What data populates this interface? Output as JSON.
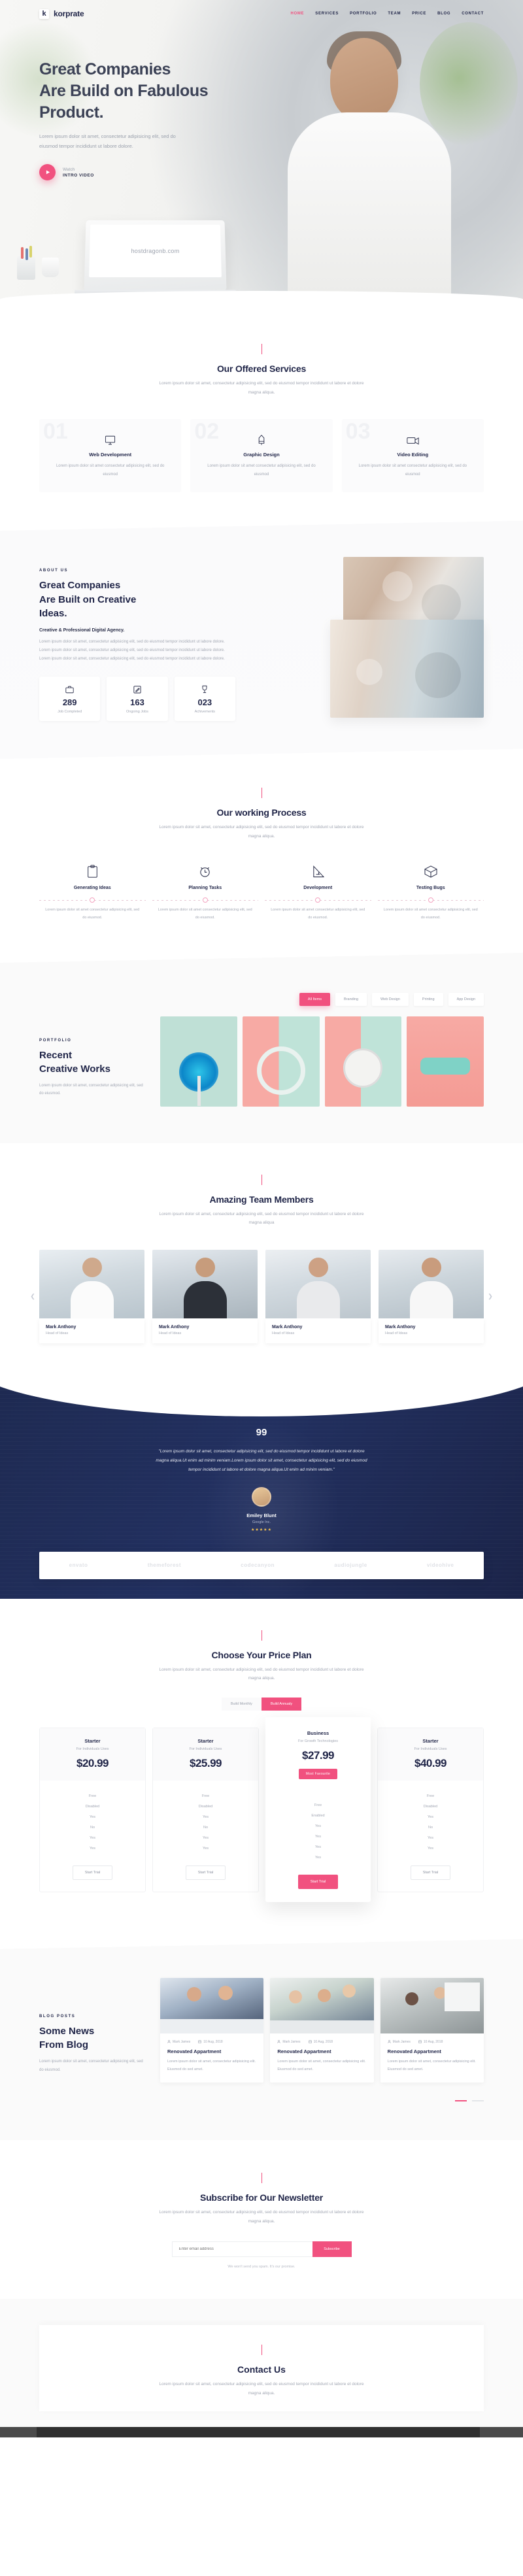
{
  "brand": {
    "mark": "k",
    "name": "korprate",
    "accent": "#f1517f",
    "dark": "#1f2447"
  },
  "nav": {
    "items": [
      {
        "label": "HOME",
        "active": true
      },
      {
        "label": "SERVICES",
        "active": false
      },
      {
        "label": "PORTFOLIO",
        "active": false
      },
      {
        "label": "TEAM",
        "active": false
      },
      {
        "label": "PRICE",
        "active": false
      },
      {
        "label": "BLOG",
        "active": false
      },
      {
        "label": "CONTACT",
        "active": false
      }
    ]
  },
  "hero": {
    "title_line1": "Great Companies",
    "title_line2": "Are Build on Fabulous",
    "title_line3": "Product.",
    "subtitle": "Lorem ipsum dolor sit amet, consectetur adipisicing elit, sed do eiusmod tempor incididunt ut labore dolore.",
    "watch_top": "Watch",
    "watch_bottom": "INTRO VIDEO",
    "screen_url": "hostdragonb.com"
  },
  "services": {
    "title": "Our Offered Services",
    "desc": "Lorem ipsum dolor sit amet, consectetur adipisicing elit, sed do eiusmod tempor incididunt ut labore et dolore magna aliqua.",
    "items": [
      {
        "num": "01",
        "icon": "monitor-icon",
        "title": "Web Development",
        "desc": "Lorem ipsum dolor sit amet consectetur adipisicing elit, sed do eiusmod"
      },
      {
        "num": "02",
        "icon": "pen-tool-icon",
        "title": "Graphic Design",
        "desc": "Lorem ipsum dolor sit amet consectetur adipisicing elit, sed do eiusmod"
      },
      {
        "num": "03",
        "icon": "camera-icon",
        "title": "Video Editing",
        "desc": "Lorem ipsum dolor sit amet consectetur adipisicing elit, sed do eiusmod"
      }
    ]
  },
  "about": {
    "eyebrow": "ABOUT US",
    "heading_line1": "Great Companies",
    "heading_line2": "Are Built on Creative",
    "heading_line3": "Ideas.",
    "subtitle": "Creative & Professional Digital Agency.",
    "paragraph": "Lorem ipsum dolor sit amet, consectetur adipisicing elit, sed do eiusmod tempor incididunt ut labore dolore. Lorem ipsum dolor sit amet, consectetur adipisicing elit, sed do eiusmod tempor incididunt ut labore dolore. Lorem ipsum dolor sit amet, consectetur adipisicing elit, sed do eiusmod tempor incididunt ut labore dolore.",
    "stats": [
      {
        "icon": "briefcase-icon",
        "number": "289",
        "label": "Job Completed"
      },
      {
        "icon": "edit-icon",
        "number": "163",
        "label": "Ongoing Jobs"
      },
      {
        "icon": "trophy-icon",
        "number": "023",
        "label": "Achivements"
      }
    ]
  },
  "process": {
    "title": "Our working Process",
    "desc": "Lorem ipsum dolor sit amet, consectetur adipisicing elit, sed do eiusmod tempor incididunt ut labore et dolore magna aliqua.",
    "steps": [
      {
        "icon": "clipboard-icon",
        "title": "Generating Ideas",
        "desc": "Lorem ipsum dolor sit amet consectetur adipisicing elit, sed do eiusmod."
      },
      {
        "icon": "alarm-clock-icon",
        "title": "Planning Tasks",
        "desc": "Lorem ipsum dolor sit amet consectetur adipisicing elit, sed do eiusmod."
      },
      {
        "icon": "ruler-icon",
        "title": "Development",
        "desc": "Lorem ipsum dolor sit amet consectetur adipisicing elit, sed do eiusmod."
      },
      {
        "icon": "box-icon",
        "title": "Testing Bugs",
        "desc": "Lorem ipsum dolor sit amet consectetur adipisicing elit, sed do eiusmod."
      }
    ]
  },
  "portfolio": {
    "eyebrow": "PORTFOLIO",
    "heading_line1": "Recent",
    "heading_line2": "Creative Works",
    "desc": "Lorem ipsum dolor sit amet, consectetur adipisicing elit, sed do eiusmod.",
    "filters": [
      {
        "label": "All Items",
        "active": true
      },
      {
        "label": "Branding",
        "active": false
      },
      {
        "label": "Web Design",
        "active": false
      },
      {
        "label": "Printing",
        "active": false
      },
      {
        "label": "App Design",
        "active": false
      }
    ],
    "items": [
      {
        "name": "lollipop-swirl",
        "bg1": "#b8ded2",
        "bg2": "#cfe6de"
      },
      {
        "name": "pink-headphones",
        "bg1": "#f7aaa4",
        "bg2": "#bfe3d8"
      },
      {
        "name": "alarm-clock",
        "bg1": "#f7aaa4",
        "bg2": "#bfe3d8"
      },
      {
        "name": "teal-car",
        "bg1": "#f7aaa4",
        "bg2": "#a9d9cf"
      }
    ]
  },
  "team": {
    "title": "Amazing Team Members",
    "desc": "Lorem ipsum dolor sit amet, consectetur adipisicing elit, sed do eiusmod tempor incididunt ut labore et dolore magna aliqua",
    "prev_icon": "chevron-left-icon",
    "next_icon": "chevron-right-icon",
    "members": [
      {
        "name": "Mark Anthony",
        "role": "Head of Ideas"
      },
      {
        "name": "Mark Anthony",
        "role": "Head of Ideas"
      },
      {
        "name": "Mark Anthony",
        "role": "Head of Ideas"
      },
      {
        "name": "Mark Anthony",
        "role": "Head of Ideas"
      }
    ]
  },
  "testimonial": {
    "quote_mark": "99",
    "quote": "\"Lorem ipsum dolor sit amet, consectetur adipisicing elit, sed do eiusmod tempor incididunt ut labore et dolore magna aliqua.Ut enim ad minim veniam.Lorem ipsum dolor sit amet, consectetur adipisicing elit, sed do eiusmod tempor incididunt ut labore et dolore magna aliqua.Ut enim ad minim veniam.\"",
    "author": "Emiley Blunt",
    "company": "Google Inc.",
    "rating": "★★★★★",
    "brands": [
      "envato",
      "themeforest",
      "codecanyon",
      "audiojungle",
      "videohive"
    ]
  },
  "pricing": {
    "title": "Choose Your Price Plan",
    "desc": "Lorem ipsum dolor sit amet, consectetur adipisicing elit, sed do eiusmod tempor incididunt ut labore et dolore magna aliqua.",
    "toggle": [
      {
        "label": "Build Monthly",
        "active": false
      },
      {
        "label": "Build Annualy",
        "active": true
      }
    ],
    "plans": [
      {
        "name": "Starter",
        "desc": "For Individuals Uses",
        "price": "$20.99",
        "badge": null,
        "features": [
          "Free",
          "Disabled",
          "Yes",
          "No",
          "Yes",
          "Yes"
        ],
        "cta": "Start Trial",
        "featured": false
      },
      {
        "name": "Starter",
        "desc": "For Individuals Uses",
        "price": "$25.99",
        "badge": null,
        "features": [
          "Free",
          "Disabled",
          "Yes",
          "No",
          "Yes",
          "Yes"
        ],
        "cta": "Start Trial",
        "featured": false
      },
      {
        "name": "Business",
        "desc": "For Growth Technologies",
        "price": "$27.99",
        "badge": "Most Favourite",
        "features": [
          "Free",
          "Enabled",
          "Yes",
          "Yes",
          "Yes",
          "Yes"
        ],
        "cta": "Start Trial",
        "featured": true
      },
      {
        "name": "Starter",
        "desc": "For Individuals Uses",
        "price": "$40.99",
        "badge": null,
        "features": [
          "Free",
          "Disabled",
          "Yes",
          "No",
          "Yes",
          "Yes"
        ],
        "cta": "Start Trial",
        "featured": false
      }
    ]
  },
  "blog": {
    "eyebrow": "BLOG POSTS",
    "heading_line1": "Some News",
    "heading_line2": "From Blog",
    "desc": "Lorem ipsum dolor sit amet, consectetur adipisicing elit, sed do eiusmod.",
    "author_icon": "user-icon",
    "date_icon": "calendar-icon",
    "posts": [
      {
        "author": "Mark James",
        "date": "10 Aug, 2018",
        "title": "Renovated Appartment",
        "excerpt": "Lorem ipsum dolor sit amet, consectetur adipisicing elit. Eiusmod do sed amet."
      },
      {
        "author": "Mark James",
        "date": "10 Aug, 2018",
        "title": "Renovated Appartment",
        "excerpt": "Lorem ipsum dolor sit amet, consectetur adipisicing elit. Eiusmod do sed amet."
      },
      {
        "author": "Mark James",
        "date": "10 Aug, 2018",
        "title": "Renovated Appartment",
        "excerpt": "Lorem ipsum dolor sit amet, consectetur adipisicing elit. Eiusmod do sed amet."
      }
    ]
  },
  "newsletter": {
    "title": "Subscribe for Our Newsletter",
    "desc": "Lorem ipsum dolor sit amet, consectetur adipisicing elit, sed do eiusmod tempor incididunt ut labore et dolore magna aliqua.",
    "placeholder": "Enter email address",
    "button": "Subscribe",
    "note": "We won't send you spam. It's our promise."
  },
  "contact": {
    "title": "Contact Us",
    "desc": "Lorem ipsum dolor sit amet, consectetur adipisicing elit, sed do eiusmod tempor incididunt ut labore et dolore magna aliqua."
  },
  "taskbar": {
    "left": "",
    "right": ""
  }
}
